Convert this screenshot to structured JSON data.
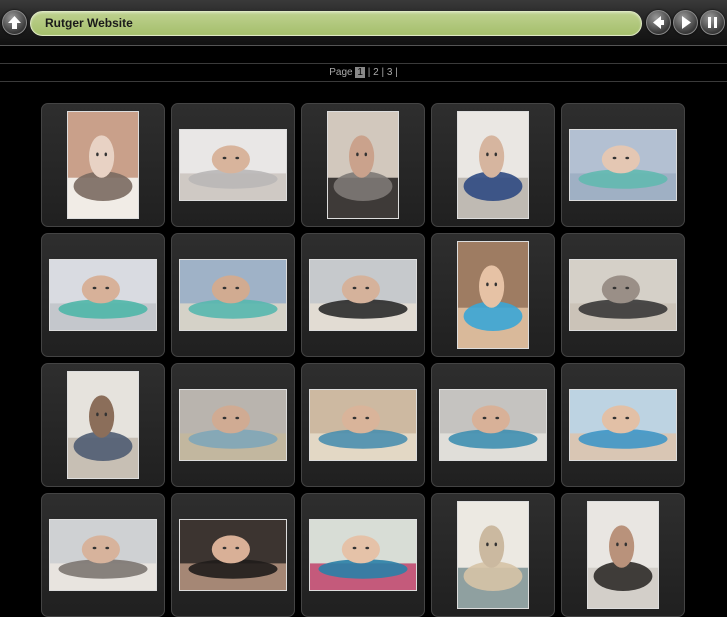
{
  "header": {
    "title": "Rutger Website",
    "buttons": [
      "up-arrow-icon",
      "prev-arrow-icon",
      "play-icon",
      "pause-icon"
    ]
  },
  "pager": {
    "label": "Page",
    "pages": [
      "1",
      "2",
      "3"
    ],
    "current": "1"
  },
  "thumbnails": [
    {
      "orient": "portrait",
      "palette": [
        "#c9a08a",
        "#e8d2c4",
        "#7a6a60",
        "#f1ece6"
      ]
    },
    {
      "orient": "landscape",
      "palette": [
        "#e9e7e6",
        "#d8b49c",
        "#b9b7b7",
        "#cfc9c4"
      ]
    },
    {
      "orient": "portrait",
      "palette": [
        "#d2c8bd",
        "#caa28c",
        "#7d7975",
        "#3e3a38"
      ]
    },
    {
      "orient": "portrait",
      "palette": [
        "#eae7e3",
        "#d6b59f",
        "#2f4a82",
        "#bfbab3"
      ]
    },
    {
      "orient": "landscape",
      "palette": [
        "#b3c0d2",
        "#e4c7b3",
        "#62b9b0",
        "#9fb0c4"
      ]
    },
    {
      "orient": "landscape",
      "palette": [
        "#d9dbe1",
        "#d7b199",
        "#4fb6a9",
        "#c4c7cc"
      ]
    },
    {
      "orient": "landscape",
      "palette": [
        "#9fb2c7",
        "#d1ab91",
        "#56b7ae",
        "#d5d2c8"
      ]
    },
    {
      "orient": "landscape",
      "palette": [
        "#c6c9cc",
        "#d5b29b",
        "#2b2b2b",
        "#e2dcd3"
      ]
    },
    {
      "orient": "portrait",
      "palette": [
        "#9e7c62",
        "#e6c2a5",
        "#3aa6d6",
        "#d9b99a"
      ]
    },
    {
      "orient": "landscape",
      "palette": [
        "#d5d0c8",
        "#9a8f87",
        "#3a3838",
        "#cbc3b8"
      ]
    },
    {
      "orient": "portrait",
      "palette": [
        "#e6e3dd",
        "#8b6e5a",
        "#4f5c72",
        "#c7bfb4"
      ]
    },
    {
      "orient": "landscape",
      "palette": [
        "#b9b4ae",
        "#d0ab93",
        "#7fa6b8",
        "#c2b79f"
      ]
    },
    {
      "orient": "landscape",
      "palette": [
        "#cdb9a1",
        "#d9b49a",
        "#4a8fae",
        "#e3d8c5"
      ]
    },
    {
      "orient": "landscape",
      "palette": [
        "#c5c3c0",
        "#d8b198",
        "#3f8fb0",
        "#e0ded9"
      ]
    },
    {
      "orient": "landscape",
      "palette": [
        "#bdd3e2",
        "#e2c0a6",
        "#3f96c6",
        "#d9c6b4"
      ]
    },
    {
      "orient": "landscape",
      "palette": [
        "#cfd1d3",
        "#d7b39c",
        "#7c7671",
        "#e8e4df"
      ]
    },
    {
      "orient": "landscape",
      "palette": [
        "#3c3430",
        "#d9b097",
        "#1f1c1b",
        "#a58775"
      ]
    },
    {
      "orient": "landscape",
      "palette": [
        "#d8ddd6",
        "#e5c2a8",
        "#2a7fa7",
        "#c45a7b"
      ]
    },
    {
      "orient": "portrait",
      "palette": [
        "#ece9e2",
        "#cbb9a0",
        "#d6c3a6",
        "#8fa0a0"
      ]
    },
    {
      "orient": "portrait",
      "palette": [
        "#e9e6e2",
        "#b9927b",
        "#2f2b29",
        "#d3cfc9"
      ]
    }
  ]
}
